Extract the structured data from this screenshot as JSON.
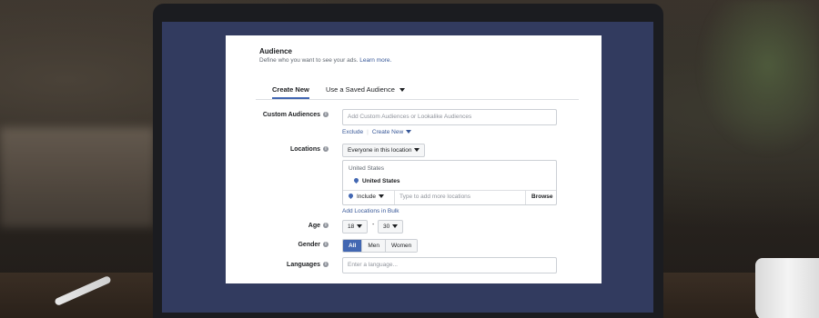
{
  "audience": {
    "title": "Audience",
    "subtitle": "Define who you want to see your ads.",
    "learn_more": "Learn more.",
    "tabs": [
      "Create New",
      "Use a Saved Audience"
    ]
  },
  "custom_audiences": {
    "label": "Custom Audiences",
    "placeholder": "Add Custom Audiences or Lookalike Audiences",
    "exclude": "Exclude",
    "create_new": "Create New"
  },
  "locations": {
    "label": "Locations",
    "dropdown": "Everyone in this location",
    "group_header": "United States",
    "selected": "United States",
    "include": "Include",
    "search_placeholder": "Type to add more locations",
    "browse": "Browse",
    "bulk_link": "Add Locations in Bulk"
  },
  "age": {
    "label": "Age",
    "min": "18",
    "dash": "-",
    "max": "30"
  },
  "gender": {
    "label": "Gender",
    "options": [
      "All",
      "Men",
      "Women"
    ],
    "selected": "All"
  },
  "languages": {
    "label": "Languages",
    "placeholder": "Enter a language..."
  },
  "colors": {
    "accent": "#4267b2",
    "link": "#385898",
    "screen_bg": "#323b5f"
  }
}
